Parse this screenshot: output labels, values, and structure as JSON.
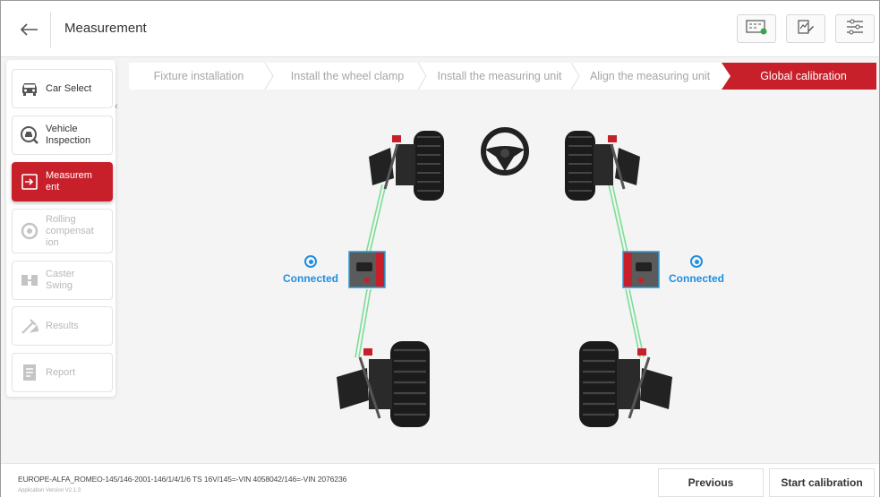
{
  "header": {
    "title": "Measurement",
    "back_icon": "arrow-left-icon",
    "action_icons": [
      "wheel-data-icon",
      "report-edit-icon",
      "settings-sliders-icon"
    ]
  },
  "sidebar": {
    "items": [
      {
        "label": "Car Select",
        "icon": "car-icon",
        "state": "normal"
      },
      {
        "label": "Vehicle\nInspection",
        "icon": "inspection-icon",
        "state": "normal"
      },
      {
        "label": "Measurem\nent",
        "icon": "measurement-icon",
        "state": "active"
      },
      {
        "label": "Rolling\ncompensat\nion",
        "icon": "rolling-icon",
        "state": "disabled"
      },
      {
        "label": "Caster\nSwing",
        "icon": "caster-icon",
        "state": "disabled"
      },
      {
        "label": "Results",
        "icon": "results-icon",
        "state": "disabled"
      },
      {
        "label": "Report",
        "icon": "report-icon",
        "state": "disabled"
      }
    ]
  },
  "steps": [
    {
      "label": "Fixture installation",
      "active": false
    },
    {
      "label": "Install the wheel clamp",
      "active": false
    },
    {
      "label": "Install the measuring unit",
      "active": false
    },
    {
      "label": "Align the measuring unit",
      "active": false
    },
    {
      "label": "Global calibration",
      "active": true
    }
  ],
  "sensors": {
    "left_status": "Connected",
    "right_status": "Connected"
  },
  "footer": {
    "vehicle_info": "EUROPE-ALFA_ROMEO-145/146-2001-146/1/4/1/6 TS 16V/145=-VIN 4058042/146=-VIN 2076236",
    "version": "Application Version V2.1.3",
    "previous_label": "Previous",
    "start_label": "Start calibration"
  },
  "colors": {
    "accent": "#c8202b",
    "connected": "#1f8fe0",
    "beam": "#6fdc8c"
  }
}
